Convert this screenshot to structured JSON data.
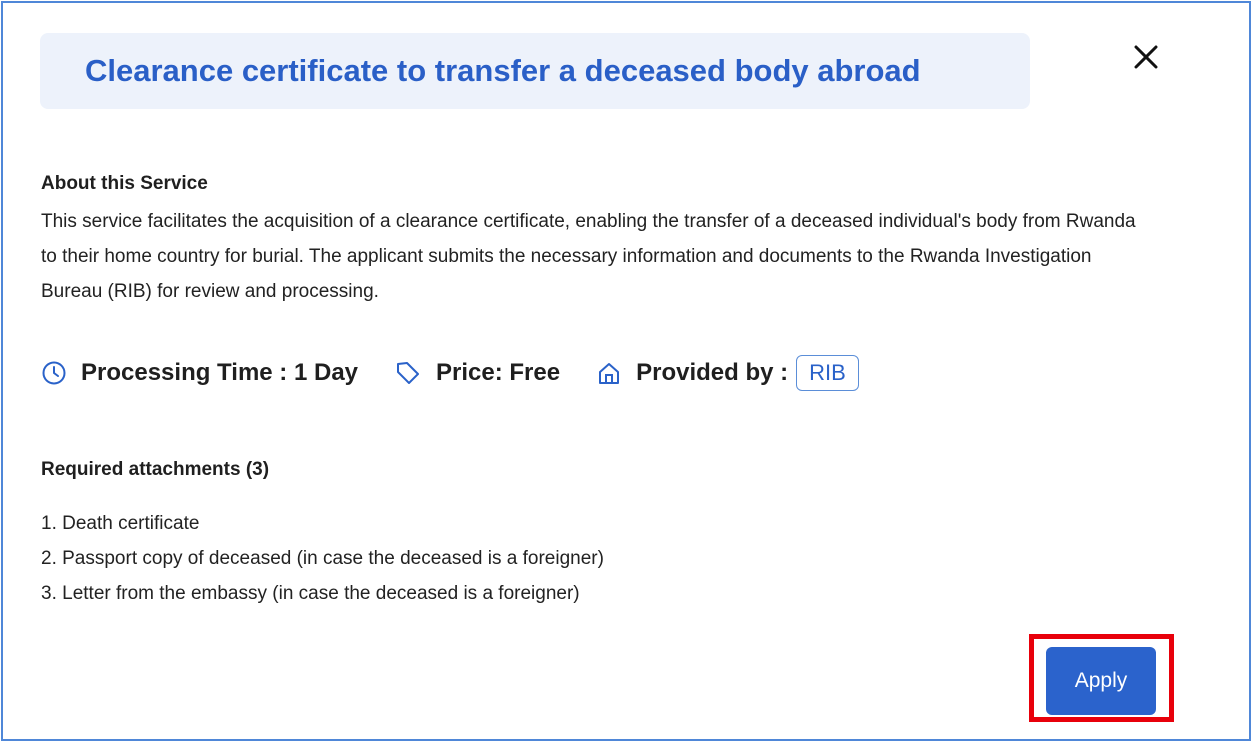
{
  "modal": {
    "title": "Clearance certificate to transfer a deceased body abroad",
    "close_icon": "close-icon",
    "about": {
      "heading": "About this Service",
      "text": "This service facilitates the acquisition of a clearance certificate, enabling the transfer of a deceased individual's body from Rwanda to their home country for burial. The applicant submits the necessary information and documents to the Rwanda Investigation Bureau (RIB) for review and processing."
    },
    "meta": {
      "processing_icon": "clock-icon",
      "processing": "Processing Time : 1 Day",
      "price_icon": "tag-icon",
      "price": "Price: Free",
      "provider_icon": "home-icon",
      "provider_label": "Provided by :",
      "provider": "RIB"
    },
    "attachments": {
      "heading": "Required attachments (3)",
      "items": [
        "1. Death certificate",
        "2. Passport copy of deceased (in case the deceased is a foreigner)",
        "3. Letter from the embassy (in case the deceased is a foreigner)"
      ]
    },
    "apply_label": "Apply"
  },
  "colors": {
    "accent": "#2b63cc",
    "title": "#2a5fc7",
    "title_bg": "#edf2fb",
    "modal_border": "#4f87d8",
    "highlight": "#e8000b"
  }
}
